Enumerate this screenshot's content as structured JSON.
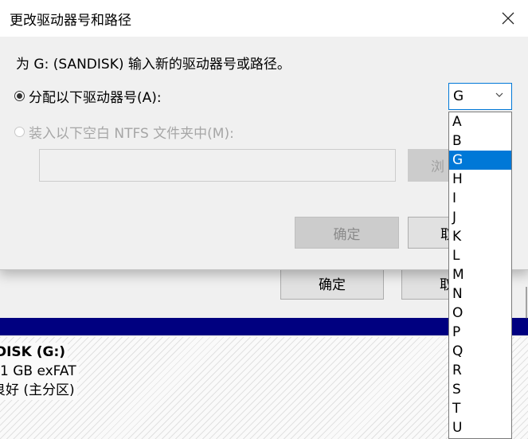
{
  "background_window": {
    "ok_label": "确定",
    "cancel_label": "取",
    "disk_name": "DISK  (G:)",
    "disk_size": "1 GB exFAT",
    "disk_status": "良好 (主分区)"
  },
  "dialog": {
    "title": "更改驱动器号和路径",
    "close_icon": "close-icon",
    "prompt": "为 G: (SANDISK) 输入新的驱动器号或路径。",
    "assign_label": "分配以下驱动器号(A):",
    "mount_label": "装入以下空白 NTFS 文件夹中(M):",
    "path_value": "",
    "browse_label": "浏",
    "ok_label": "确定",
    "cancel_label": "取",
    "drive_letter": {
      "selected": "G",
      "options": [
        "A",
        "B",
        "G",
        "H",
        "I",
        "J",
        "K",
        "L",
        "M",
        "N",
        "O",
        "P",
        "Q",
        "R",
        "S",
        "T",
        "U"
      ]
    }
  },
  "colors": {
    "accent": "#0078d7",
    "navy_bar": "#000080",
    "dialog_bg": "#f0f0f0"
  }
}
